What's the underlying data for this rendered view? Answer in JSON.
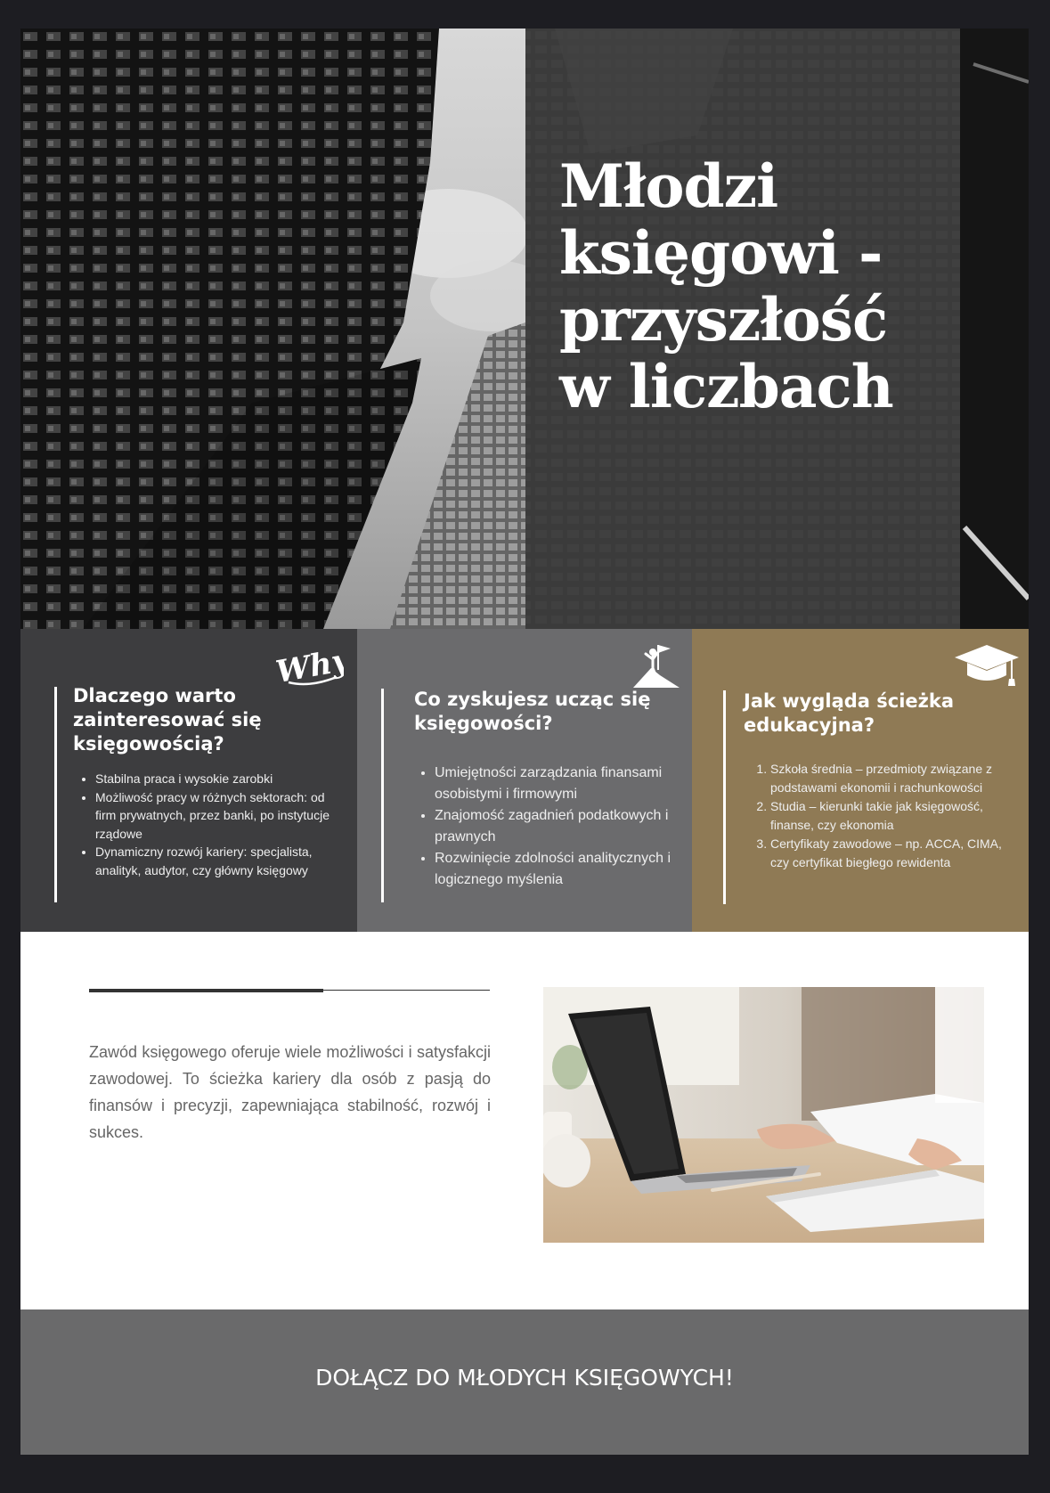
{
  "hero": {
    "title": "Młodzi księgowi - przyszłość w liczbach"
  },
  "boxes": [
    {
      "icon": "why-question-icon",
      "icon_text": "Why?",
      "heading": "Dlaczego warto zainteresować się księgowością?",
      "items": [
        "Stabilna praca i wysokie zarobki",
        "Możliwość pracy w różnych sektorach: od firm prywatnych, przez banki, po instytucje rządowe",
        "Dynamiczny rozwój kariery: specjalista, analityk, audytor, czy główny księgowy"
      ]
    },
    {
      "icon": "summit-flag-icon",
      "heading": "Co zyskujesz ucząc się księgowości?",
      "items": [
        "Umiejętności zarządzania finansami osobistymi i firmowymi",
        "Znajomość zagadnień podatkowych i prawnych",
        "Rozwinięcie zdolności analitycznych i logicznego myślenia"
      ]
    },
    {
      "icon": "graduation-cap-icon",
      "heading": "Jak wygląda ścieżka edukacyjna?",
      "items": [
        "Szkoła średnia – przedmioty związane z podstawami ekonomii i rachunkowości",
        "Studia – kierunki takie jak księgowość, finanse, czy ekonomia",
        "Certyfikaty zawodowe – np. ACCA, CIMA, czy certyfikat biegłego rewidenta"
      ]
    }
  ],
  "middle": {
    "text": "Zawód księgowego oferuje wiele możliwości i satysfakcji zawodowej. To ścieżka kariery dla osób z pasją do finansów i precyzji, zapewniająca stabilność, rozwój i sukces."
  },
  "footer": {
    "cta": "DOŁĄCZ DO MŁODYCH KSIĘGOWYCH!"
  },
  "colors": {
    "box1": "#3d3d3f",
    "box2": "#6b6b6d",
    "box3": "#8f7a55",
    "footer": "#6a6a6b"
  }
}
